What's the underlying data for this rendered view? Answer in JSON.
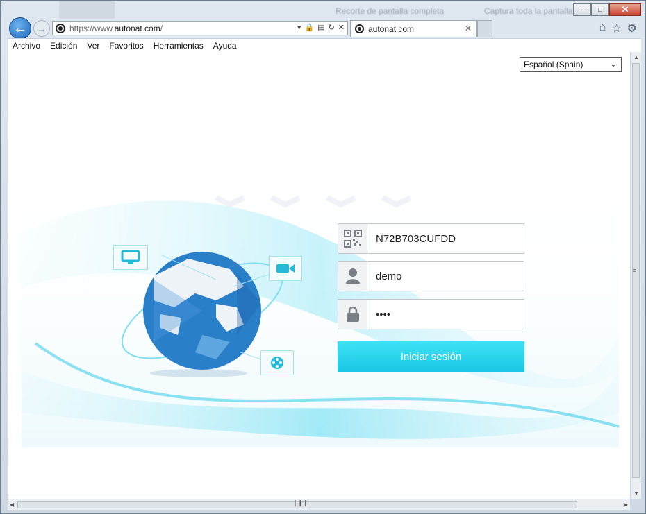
{
  "browser": {
    "address": {
      "prefix": "https://www.",
      "host": "autonat.com",
      "suffix": "/"
    },
    "tab_title": "autonat.com",
    "menu": [
      "Archivo",
      "Edición",
      "Ver",
      "Favoritos",
      "Herramientas",
      "Ayuda"
    ],
    "ghost_titles": [
      "Recorte de pantalla completa",
      "Captura toda la pantalla"
    ]
  },
  "page": {
    "language": "Español (Spain)",
    "device_id": "N72B703CUFDD",
    "username": "demo",
    "password": "1234",
    "login_label": "Iniciar sesión"
  },
  "colors": {
    "accent": "#1ac7e4",
    "globe": "#2a7fc9"
  },
  "icons": [
    "back-arrow-icon",
    "forward-arrow-icon",
    "lock-icon",
    "refresh-icon",
    "close-icon",
    "home-icon",
    "star-icon",
    "gear-icon",
    "qr-code-icon",
    "user-icon",
    "padlock-icon",
    "monitor-icon",
    "video-camera-icon",
    "film-reel-icon",
    "globe-icon"
  ]
}
